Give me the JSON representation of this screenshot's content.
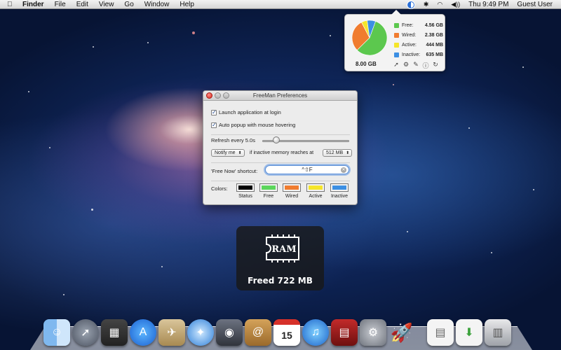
{
  "menubar": {
    "app_name": "Finder",
    "menus": [
      "File",
      "Edit",
      "View",
      "Go",
      "Window",
      "Help"
    ],
    "clock": "Thu 9:49 PM",
    "user": "Guest User"
  },
  "popover": {
    "total": "8.00 GB",
    "memory": [
      {
        "label": "Free:",
        "value": "4.56 GB",
        "color": "#5cc84e"
      },
      {
        "label": "Wired:",
        "value": "2.38 GB",
        "color": "#f07c2f"
      },
      {
        "label": "Active:",
        "value": "444 MB",
        "color": "#f5e52a"
      },
      {
        "label": "Inactive:",
        "value": "635 MB",
        "color": "#3c8fe3"
      }
    ],
    "icons": [
      "rocket-icon",
      "gear-icon",
      "pencil-icon",
      "info-icon",
      "refresh-icon"
    ]
  },
  "prefs": {
    "title": "FreeMan Preferences",
    "launch_at_login": "Launch application at login",
    "auto_popup": "Auto popup with mouse hovering",
    "refresh_label": "Refresh every 5.0s",
    "notify_option": "Notify me",
    "notify_text": "if inactive memory reaches at",
    "threshold": "512 MB",
    "shortcut_label": "'Free Now' shortcut:",
    "shortcut_value": "^⇧F",
    "colors_label": "Colors:",
    "colors": [
      {
        "name": "Status",
        "color": "#000000"
      },
      {
        "name": "Free",
        "color": "#5cd65c"
      },
      {
        "name": "Wired",
        "color": "#f07c2f"
      },
      {
        "name": "Active",
        "color": "#f5e52a"
      },
      {
        "name": "Inactive",
        "color": "#3c8fe3"
      }
    ]
  },
  "hud": {
    "chip_label": "RAM",
    "message": "Freed 722 MB"
  },
  "calendar": {
    "day": "15",
    "month": "JUL"
  }
}
